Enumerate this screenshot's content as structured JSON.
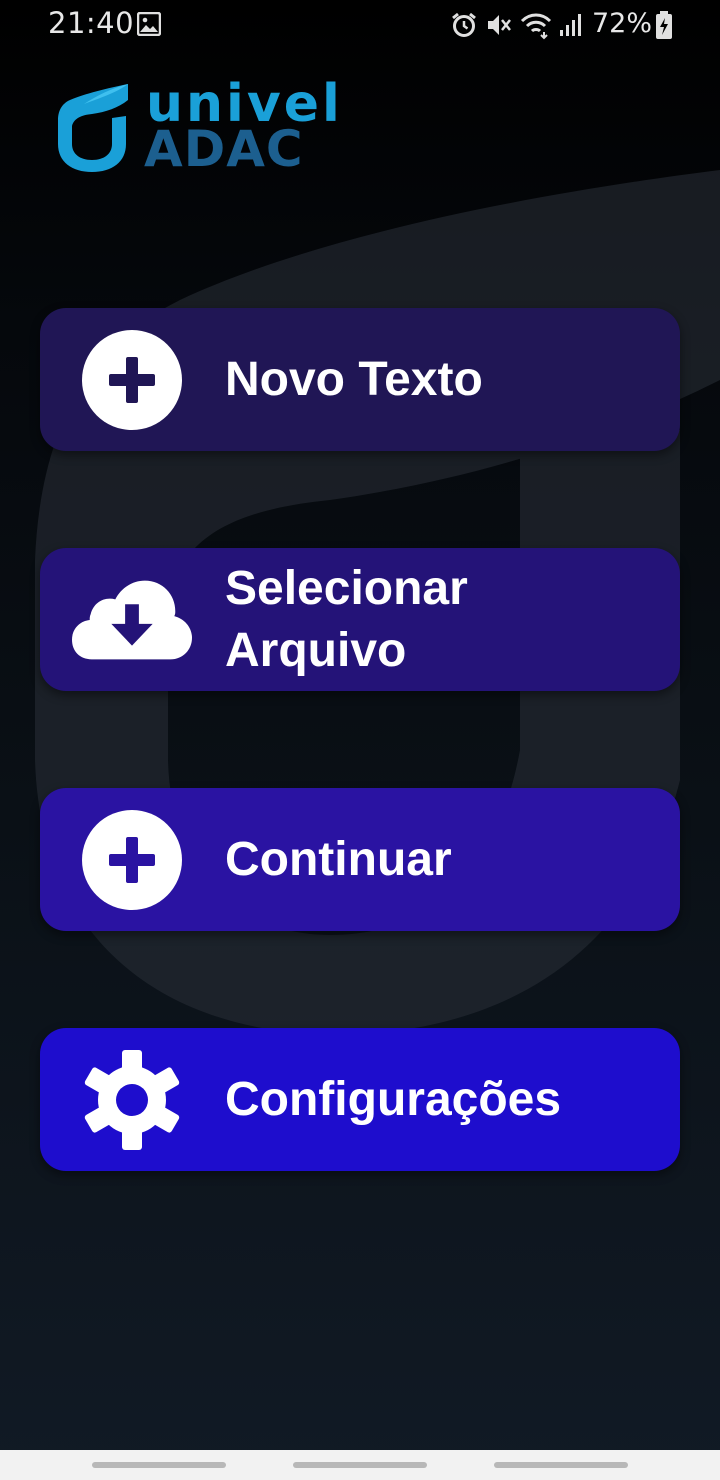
{
  "status_bar": {
    "time": "21:40",
    "battery_percent": "72%",
    "icons": [
      "image-icon",
      "alarm-icon",
      "mute-icon",
      "wifi-icon",
      "signal-icon",
      "battery-charging-icon"
    ]
  },
  "logo": {
    "line1": "univel",
    "line2": "ADAC",
    "colors": {
      "light": "#1aa0d8",
      "dark": "#1c5f8f"
    }
  },
  "menu": {
    "items": [
      {
        "label": "Novo Texto",
        "icon": "plus-circle-icon",
        "color": "#201655"
      },
      {
        "label": "Selecionar Arquivo",
        "icon": "cloud-download-icon",
        "color": "#241378"
      },
      {
        "label": "Continuar",
        "icon": "plus-circle-icon",
        "color": "#2a13a2"
      },
      {
        "label": "Configurações",
        "icon": "gear-icon",
        "color": "#1e0dcd"
      }
    ]
  },
  "colors": {
    "background_top": "#000000",
    "background_bottom": "#111a25",
    "nav_bar": "#f2f2f2"
  }
}
